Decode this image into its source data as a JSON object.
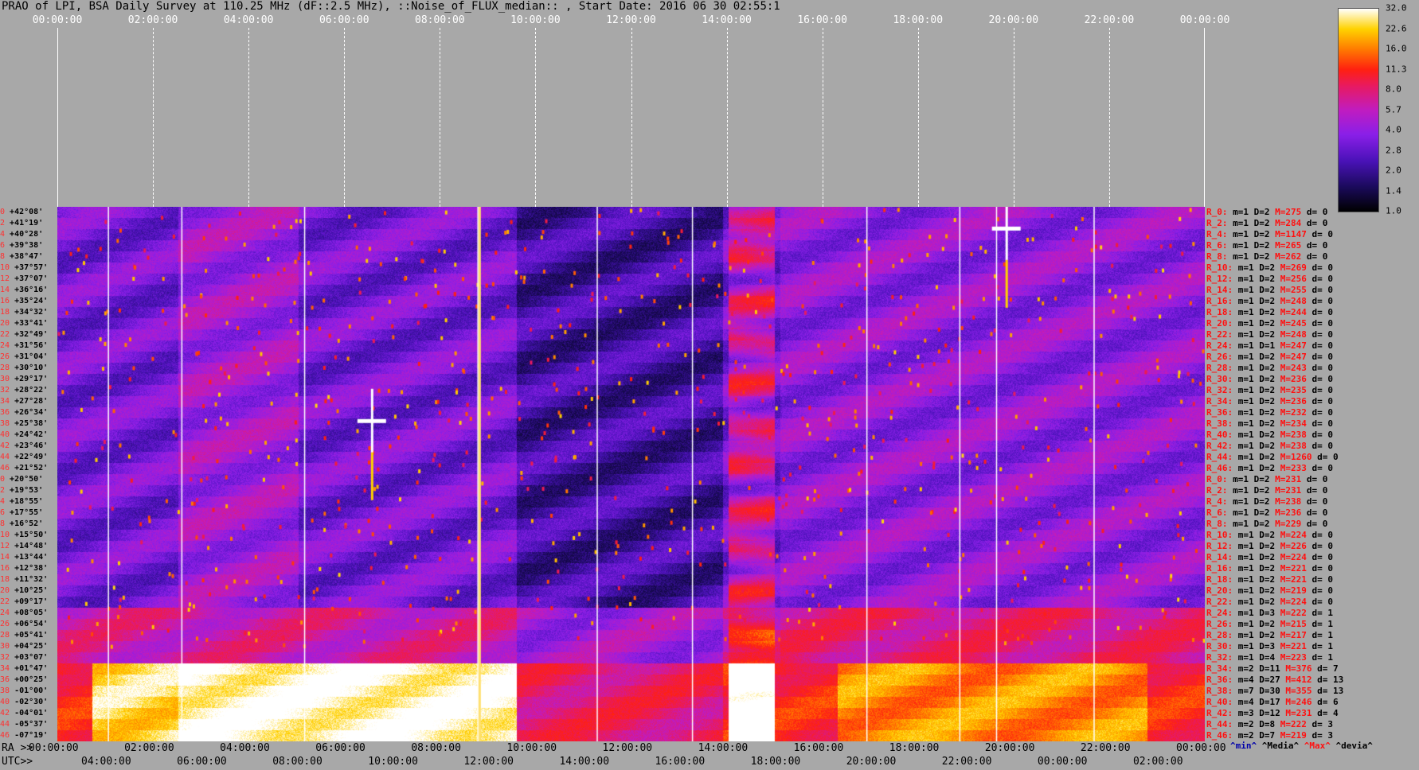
{
  "title": "PRAO of LPI, BSA Daily Survey at 110.25 MHz (dF::2.5 MHz), ::Noise_of_FLUX_median:: , Start Date: 2016 06 30 02:55:1",
  "top_axis": {
    "ticks": [
      "00:00:00",
      "02:00:00",
      "04:00:00",
      "06:00:00",
      "08:00:00",
      "10:00:00",
      "12:00:00",
      "14:00:00",
      "16:00:00",
      "18:00:00",
      "20:00:00",
      "22:00:00",
      "00:00:00"
    ]
  },
  "ra_axis": {
    "label": "RA >>",
    "ticks": [
      "00:00:00",
      "02:00:00",
      "04:00:00",
      "06:00:00",
      "08:00:00",
      "10:00:00",
      "12:00:00",
      "14:00:00",
      "16:00:00",
      "18:00:00",
      "20:00:00",
      "22:00:00",
      "00:00:00"
    ]
  },
  "utc_axis": {
    "label": "UTC>>",
    "ticks": [
      "04:00:00",
      "06:00:00",
      "08:00:00",
      "10:00:00",
      "12:00:00",
      "14:00:00",
      "16:00:00",
      "18:00:00",
      "20:00:00",
      "22:00:00",
      "00:00:00",
      "02:00:00"
    ]
  },
  "colorbar": {
    "ticks": [
      "32.0",
      "22.6",
      "16.0",
      "11.3",
      "8.0",
      "5.7",
      "4.0",
      "2.8",
      "2.0",
      "1.4",
      "1.0"
    ],
    "colors": [
      "#000000",
      "#1a0a5a",
      "#4a12b8",
      "#8a1fe8",
      "#c01cc0",
      "#e81a60",
      "#ff2010",
      "#ff7a00",
      "#ffd200",
      "#ffffff"
    ]
  },
  "legend": {
    "min": "^min^",
    "media": "^Media^",
    "max": "^Max^",
    "devia": "^devia^"
  },
  "chart_data": {
    "type": "heatmap",
    "title": "PRAO of LPI, BSA Daily Survey at 110.25 MHz (dF::2.5 MHz), ::Noise_of_FLUX_median:: , Start Date: 2016 06 30 02:55:1",
    "xlabel": "RA",
    "ylabel": "",
    "declinations": [
      "+42°08'",
      "+41°19'",
      "+40°28'",
      "+39°38'",
      "+38°47'",
      "+37°57'",
      "+37°07'",
      "+36°16'",
      "+35°24'",
      "+34°32'",
      "+33°41'",
      "+32°49'",
      "+31°56'",
      "+31°04'",
      "+30°10'",
      "+29°17'",
      "+28°22'",
      "+27°28'",
      "+26°34'",
      "+25°38'",
      "+24°42'",
      "+23°46'",
      "+22°49'",
      "+21°52'",
      "+20°50'",
      "+19°53'",
      "+18°55'",
      "+17°55'",
      "+16°52'",
      "+15°50'",
      "+14°48'",
      "+13°44'",
      "+12°38'",
      "+11°32'",
      "+10°25'",
      "+09°17'",
      "+08°05'",
      "+06°54'",
      "+05°41'",
      "+04°25'",
      "+03°07'",
      "+01°47'",
      "+00°25'",
      "-01°00'",
      "-02°30'",
      "-04°01'",
      "-05°37'",
      "-07°19'"
    ],
    "row_numbers": [
      "0",
      "2",
      "4",
      "6",
      "8",
      "10",
      "12",
      "14",
      "16",
      "18",
      "20",
      "22",
      "24",
      "26",
      "28",
      "30",
      "32",
      "34",
      "36",
      "38",
      "40",
      "42",
      "44",
      "46",
      "0",
      "2",
      "4",
      "6",
      "8",
      "10",
      "12",
      "14",
      "16",
      "18",
      "20",
      "22",
      "24",
      "26",
      "28",
      "30",
      "32",
      "34",
      "36",
      "38",
      "40",
      "42",
      "44",
      "46"
    ],
    "colorbar_range": [
      1.0,
      32.0
    ],
    "stats": [
      {
        "r": "R_0:",
        "m": "m=1",
        "d": "D=2",
        "M": "M=275",
        "dev": "d= 0"
      },
      {
        "r": "R_2:",
        "m": "m=1",
        "d": "D=2",
        "M": "M=284",
        "dev": "d= 0"
      },
      {
        "r": "R_4:",
        "m": "m=1",
        "d": "D=2",
        "M": "M=1147",
        "dev": "d= 0"
      },
      {
        "r": "R_6:",
        "m": "m=1",
        "d": "D=2",
        "M": "M=265",
        "dev": "d= 0"
      },
      {
        "r": "R_8:",
        "m": "m=1",
        "d": "D=2",
        "M": "M=262",
        "dev": "d= 0"
      },
      {
        "r": "R_10:",
        "m": "m=1",
        "d": "D=2",
        "M": "M=269",
        "dev": "d= 0"
      },
      {
        "r": "R_12:",
        "m": "m=1",
        "d": "D=2",
        "M": "M=256",
        "dev": "d= 0"
      },
      {
        "r": "R_14:",
        "m": "m=1",
        "d": "D=2",
        "M": "M=255",
        "dev": "d= 0"
      },
      {
        "r": "R_16:",
        "m": "m=1",
        "d": "D=2",
        "M": "M=248",
        "dev": "d= 0"
      },
      {
        "r": "R_18:",
        "m": "m=1",
        "d": "D=2",
        "M": "M=244",
        "dev": "d= 0"
      },
      {
        "r": "R_20:",
        "m": "m=1",
        "d": "D=2",
        "M": "M=245",
        "dev": "d= 0"
      },
      {
        "r": "R_22:",
        "m": "m=1",
        "d": "D=2",
        "M": "M=248",
        "dev": "d= 0"
      },
      {
        "r": "R_24:",
        "m": "m=1",
        "d": "D=1",
        "M": "M=247",
        "dev": "d= 0"
      },
      {
        "r": "R_26:",
        "m": "m=1",
        "d": "D=2",
        "M": "M=247",
        "dev": "d= 0"
      },
      {
        "r": "R_28:",
        "m": "m=1",
        "d": "D=2",
        "M": "M=243",
        "dev": "d= 0"
      },
      {
        "r": "R_30:",
        "m": "m=1",
        "d": "D=2",
        "M": "M=236",
        "dev": "d= 0"
      },
      {
        "r": "R_32:",
        "m": "m=1",
        "d": "D=2",
        "M": "M=235",
        "dev": "d= 0"
      },
      {
        "r": "R_34:",
        "m": "m=1",
        "d": "D=2",
        "M": "M=236",
        "dev": "d= 0"
      },
      {
        "r": "R_36:",
        "m": "m=1",
        "d": "D=2",
        "M": "M=232",
        "dev": "d= 0"
      },
      {
        "r": "R_38:",
        "m": "m=1",
        "d": "D=2",
        "M": "M=234",
        "dev": "d= 0"
      },
      {
        "r": "R_40:",
        "m": "m=1",
        "d": "D=2",
        "M": "M=238",
        "dev": "d= 0"
      },
      {
        "r": "R_42:",
        "m": "m=1",
        "d": "D=2",
        "M": "M=238",
        "dev": "d= 0"
      },
      {
        "r": "R_44:",
        "m": "m=1",
        "d": "D=2",
        "M": "M=1260",
        "dev": "d= 0"
      },
      {
        "r": "R_46:",
        "m": "m=1",
        "d": "D=2",
        "M": "M=233",
        "dev": "d= 0"
      },
      {
        "r": "R_0:",
        "m": "m=1",
        "d": "D=2",
        "M": "M=231",
        "dev": "d= 0"
      },
      {
        "r": "R_2:",
        "m": "m=1",
        "d": "D=2",
        "M": "M=231",
        "dev": "d= 0"
      },
      {
        "r": "R_4:",
        "m": "m=1",
        "d": "D=2",
        "M": "M=238",
        "dev": "d= 0"
      },
      {
        "r": "R_6:",
        "m": "m=1",
        "d": "D=2",
        "M": "M=236",
        "dev": "d= 0"
      },
      {
        "r": "R_8:",
        "m": "m=1",
        "d": "D=2",
        "M": "M=229",
        "dev": "d= 0"
      },
      {
        "r": "R_10:",
        "m": "m=1",
        "d": "D=2",
        "M": "M=224",
        "dev": "d= 0"
      },
      {
        "r": "R_12:",
        "m": "m=1",
        "d": "D=2",
        "M": "M=226",
        "dev": "d= 0"
      },
      {
        "r": "R_14:",
        "m": "m=1",
        "d": "D=2",
        "M": "M=224",
        "dev": "d= 0"
      },
      {
        "r": "R_16:",
        "m": "m=1",
        "d": "D=2",
        "M": "M=221",
        "dev": "d= 0"
      },
      {
        "r": "R_18:",
        "m": "m=1",
        "d": "D=2",
        "M": "M=221",
        "dev": "d= 0"
      },
      {
        "r": "R_20:",
        "m": "m=1",
        "d": "D=2",
        "M": "M=219",
        "dev": "d= 0"
      },
      {
        "r": "R_22:",
        "m": "m=1",
        "d": "D=2",
        "M": "M=224",
        "dev": "d= 0"
      },
      {
        "r": "R_24:",
        "m": "m=1",
        "d": "D=3",
        "M": "M=222",
        "dev": "d= 1"
      },
      {
        "r": "R_26:",
        "m": "m=1",
        "d": "D=2",
        "M": "M=215",
        "dev": "d= 1"
      },
      {
        "r": "R_28:",
        "m": "m=1",
        "d": "D=2",
        "M": "M=217",
        "dev": "d= 1"
      },
      {
        "r": "R_30:",
        "m": "m=1",
        "d": "D=3",
        "M": "M=221",
        "dev": "d= 1"
      },
      {
        "r": "R_32:",
        "m": "m=1",
        "d": "D=4",
        "M": "M=223",
        "dev": "d= 1"
      },
      {
        "r": "R_34:",
        "m": "m=2",
        "d": "D=11",
        "M": "M=376",
        "dev": "d= 7"
      },
      {
        "r": "R_36:",
        "m": "m=4",
        "d": "D=27",
        "M": "M=412",
        "dev": "d= 13"
      },
      {
        "r": "R_38:",
        "m": "m=7",
        "d": "D=30",
        "M": "M=355",
        "dev": "d= 13"
      },
      {
        "r": "R_40:",
        "m": "m=4",
        "d": "D=17",
        "M": "M=246",
        "dev": "d= 6"
      },
      {
        "r": "R_42:",
        "m": "m=3",
        "d": "D=12",
        "M": "M=231",
        "dev": "d= 4"
      },
      {
        "r": "R_44:",
        "m": "m=2",
        "d": "D=8",
        "M": "M=222",
        "dev": "d= 3"
      },
      {
        "r": "R_46:",
        "m": "m=2",
        "d": "D=7",
        "M": "M=219",
        "dev": "d= 3"
      }
    ]
  }
}
